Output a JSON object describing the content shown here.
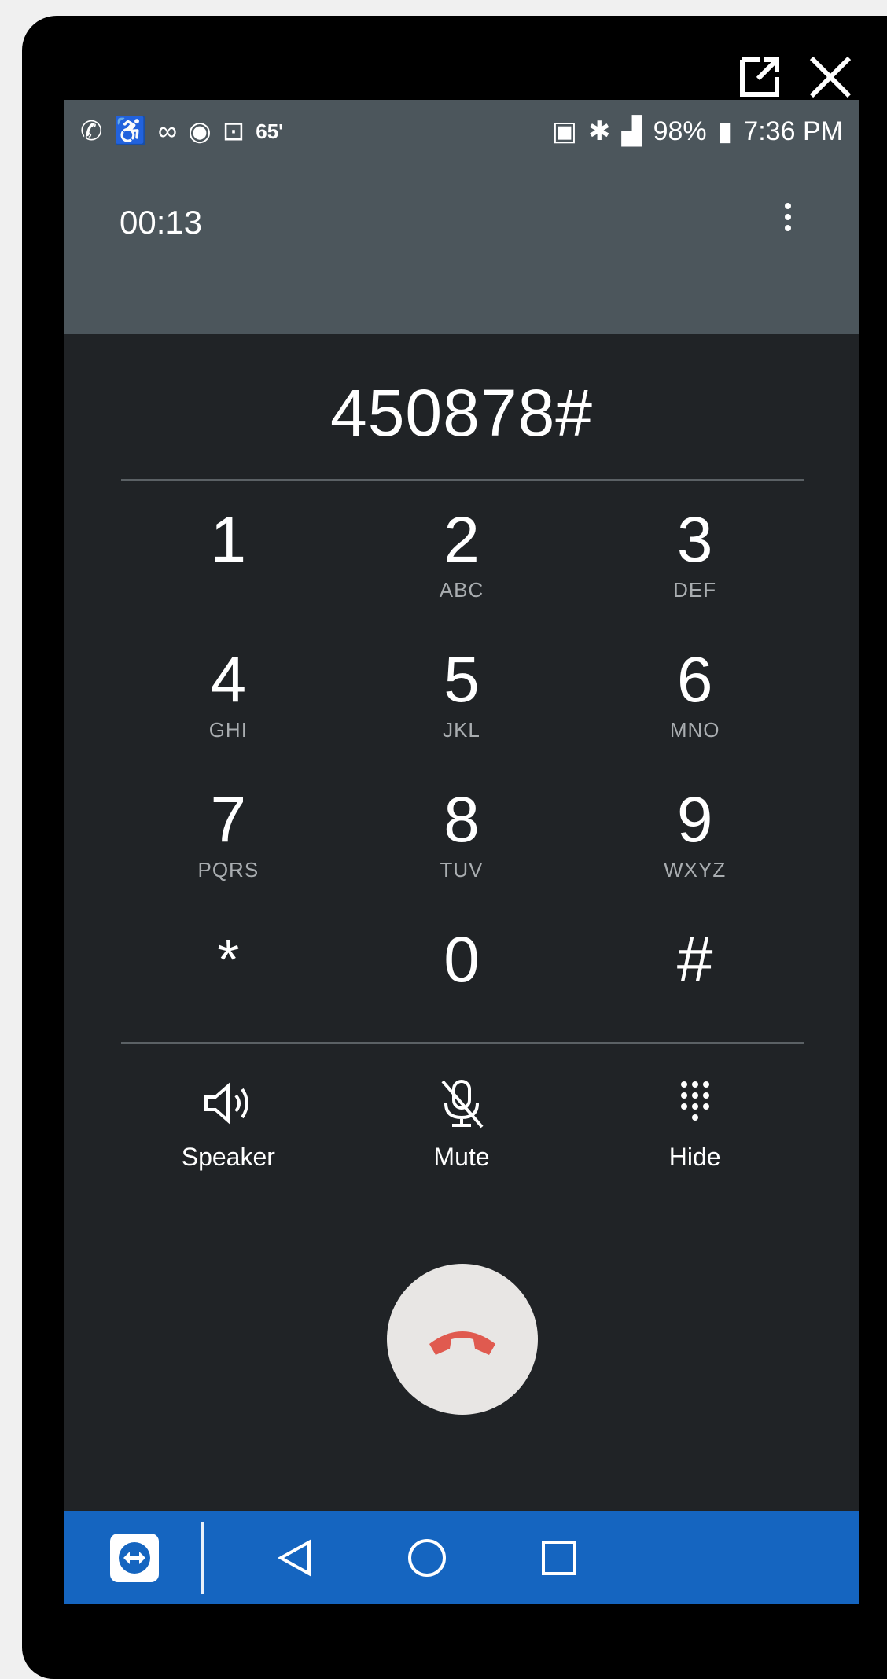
{
  "status_bar": {
    "left_icons": [
      "call-forward-icon",
      "accessibility-icon",
      "voicemail-icon",
      "eye-icon",
      "teamviewer-icon"
    ],
    "temperature": "65'",
    "right_icons": [
      "cast-icon",
      "bluetooth-icon",
      "signal-icon"
    ],
    "battery": "98%",
    "time": "7:36 PM"
  },
  "call": {
    "timer": "00:13",
    "dialed_number": "450878#"
  },
  "keypad": [
    {
      "digit": "1",
      "letters": ""
    },
    {
      "digit": "2",
      "letters": "ABC"
    },
    {
      "digit": "3",
      "letters": "DEF"
    },
    {
      "digit": "4",
      "letters": "GHI"
    },
    {
      "digit": "5",
      "letters": "JKL"
    },
    {
      "digit": "6",
      "letters": "MNO"
    },
    {
      "digit": "7",
      "letters": "PQRS"
    },
    {
      "digit": "8",
      "letters": "TUV"
    },
    {
      "digit": "9",
      "letters": "WXYZ"
    },
    {
      "digit": "*",
      "letters": ""
    },
    {
      "digit": "0",
      "letters": ""
    },
    {
      "digit": "#",
      "letters": ""
    }
  ],
  "actions": {
    "speaker": "Speaker",
    "mute": "Mute",
    "hide": "Hide"
  },
  "colors": {
    "header": "#4c565c",
    "background": "#202326",
    "end_call": "#e05a4f",
    "nav": "#1565c0"
  }
}
